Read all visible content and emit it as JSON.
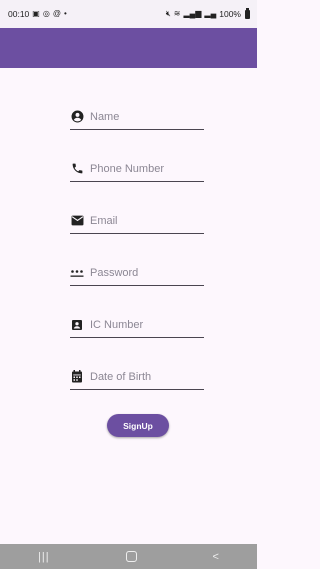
{
  "status_bar": {
    "time": "00:10",
    "left_icons": [
      "gallery-icon",
      "instagram-icon",
      "at-icon",
      "dot-icon"
    ],
    "right_icons": [
      "mute-icon",
      "wifi-icon",
      "signal-icon",
      "signal-2-icon"
    ],
    "battery": "100%"
  },
  "app_bar": {
    "color": "#6c4fa1"
  },
  "form": {
    "fields": [
      {
        "icon": "person-icon",
        "placeholder": "Name"
      },
      {
        "icon": "phone-icon",
        "placeholder": "Phone Number"
      },
      {
        "icon": "mail-icon",
        "placeholder": "Email"
      },
      {
        "icon": "password-icon",
        "placeholder": "Password"
      },
      {
        "icon": "id-card-icon",
        "placeholder": "IC Number"
      },
      {
        "icon": "calendar-icon",
        "placeholder": "Date of Birth"
      }
    ],
    "signup_label": "SignUp"
  },
  "nav_bar": {
    "recent": "|||",
    "back": "<"
  },
  "colors": {
    "accent": "#6c4fa1",
    "background": "#fdf7fd",
    "placeholder": "#8c8794"
  }
}
